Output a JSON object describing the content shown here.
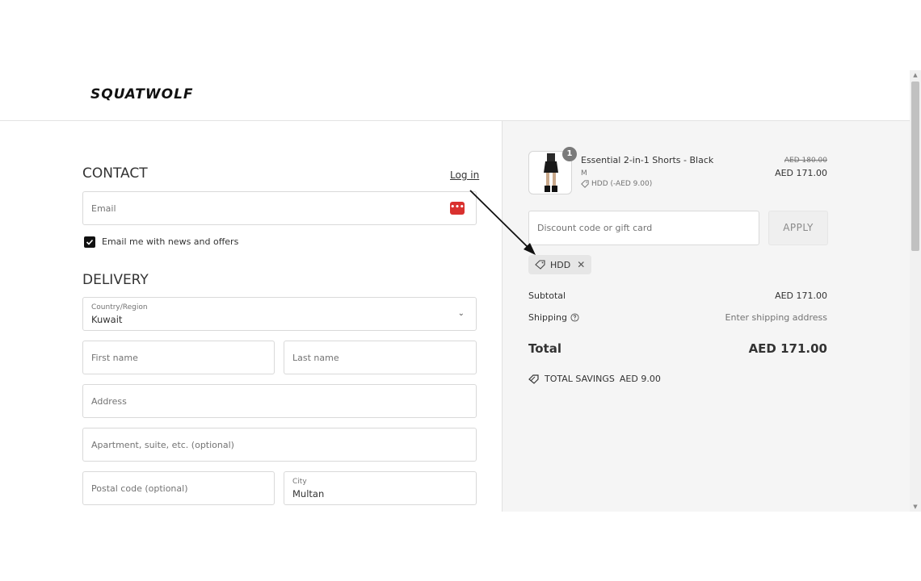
{
  "brand": {
    "logo": "SQUATWOLF"
  },
  "contact": {
    "title": "CONTACT",
    "login_link": "Log in",
    "email_placeholder": "Email",
    "newsletter_label": "Email me with news and offers",
    "newsletter_checked": true
  },
  "delivery": {
    "title": "DELIVERY",
    "country_label": "Country/Region",
    "country_value": "Kuwait",
    "first_name_placeholder": "First name",
    "last_name_placeholder": "Last name",
    "address_placeholder": "Address",
    "apartment_placeholder": "Apartment, suite, etc. (optional)",
    "postal_placeholder": "Postal code (optional)",
    "city_label": "City",
    "city_value": "Multan"
  },
  "summary": {
    "item": {
      "quantity": "1",
      "name": "Essential 2-in-1 Shorts - Black",
      "variant": "M",
      "discount": "HDD (-AED 9.00)",
      "price_original": "AED 180.00",
      "price_final": "AED 171.00"
    },
    "discount_placeholder": "Discount code or gift card",
    "apply_label": "APPLY",
    "applied_code": "HDD",
    "subtotal_label": "Subtotal",
    "subtotal_value": "AED 171.00",
    "shipping_label": "Shipping",
    "shipping_value": "Enter shipping address",
    "total_label": "Total",
    "total_value": "AED 171.00",
    "savings_label": "TOTAL SAVINGS",
    "savings_value": "AED 9.00"
  },
  "colors": {
    "accent_badge": "#d9312f",
    "summary_bg": "#f5f5f5"
  },
  "icons": [
    "email-autofill-icon",
    "checkbox-check-icon",
    "chevron-down-icon",
    "tag-icon",
    "close-icon",
    "help-circle-icon",
    "savings-tag-icon",
    "scroll-up-icon",
    "scroll-down-icon"
  ]
}
